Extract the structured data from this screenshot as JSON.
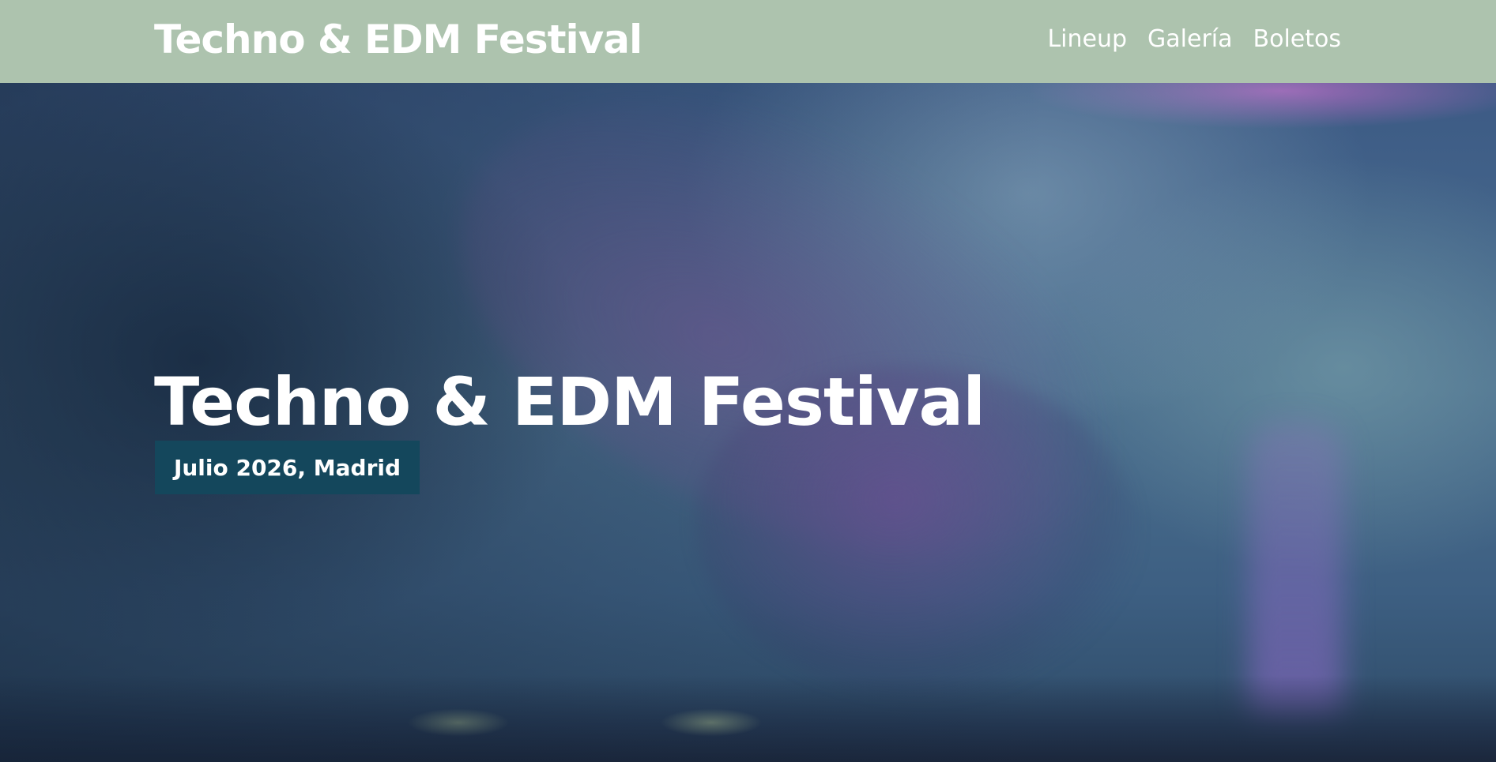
{
  "header": {
    "brand": "Techno & EDM Festival",
    "nav": [
      {
        "label": "Lineup"
      },
      {
        "label": "Galería"
      },
      {
        "label": "Boletos"
      }
    ]
  },
  "hero": {
    "title": "Techno & EDM Festival",
    "date": "Julio 2026, Madrid"
  },
  "colors": {
    "header_bg": "#adc3ae",
    "date_badge_bg": "#14475c",
    "text": "#ffffff"
  }
}
